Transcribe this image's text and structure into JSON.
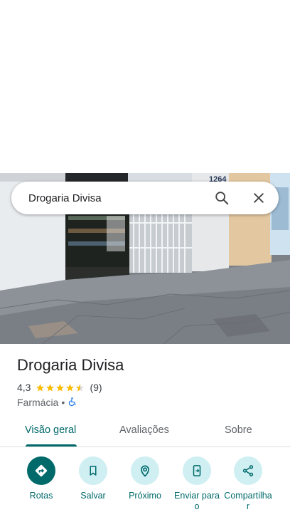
{
  "search": {
    "query": "Drogaria Divisa"
  },
  "photo": {
    "sign_number": "1264"
  },
  "place": {
    "name": "Drogaria Divisa",
    "rating": "4,3",
    "rating_value": 4.3,
    "review_count": "(9)",
    "category": "Farmácia",
    "separator": "•",
    "accessibility_icon": "wheelchair-icon"
  },
  "tabs": [
    {
      "label": "Visão geral",
      "active": true
    },
    {
      "label": "Avaliações",
      "active": false
    },
    {
      "label": "Sobre",
      "active": false
    }
  ],
  "actions": [
    {
      "label": "Rotas",
      "icon": "directions-icon"
    },
    {
      "label": "Salvar",
      "icon": "bookmark-icon"
    },
    {
      "label": "Próximo",
      "icon": "nearby-icon"
    },
    {
      "label": "Enviar para o",
      "icon": "send-to-phone-icon"
    },
    {
      "label": "Compartilhar",
      "icon": "share-icon"
    }
  ],
  "colors": {
    "accent": "#00696a",
    "action_bg": "#cfeff3",
    "star": "#fbbc04"
  }
}
